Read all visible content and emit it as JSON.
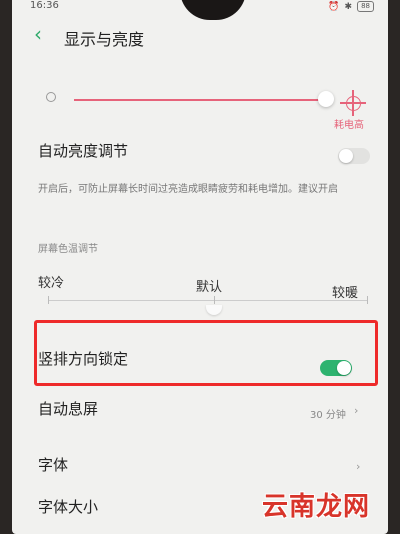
{
  "status_bar": {
    "time": "16:36",
    "battery": "88"
  },
  "header": {
    "title": "显示与亮度"
  },
  "brightness": {
    "level": 0.95,
    "high_label": "耗电高"
  },
  "auto_brightness": {
    "label": "自动亮度调节",
    "enabled": false,
    "description": "开启后，可防止屏幕长时间过亮造成眼睛疲劳和耗电增加。建议开启"
  },
  "color_temperature": {
    "section_label": "屏幕色温调节",
    "cool_label": "较冷",
    "default_label": "默认",
    "warm_label": "较暖",
    "level": 0.5
  },
  "orientation_lock": {
    "label": "竖排方向锁定",
    "enabled": true
  },
  "auto_screen_off": {
    "label": "自动息屏",
    "value": "30 分钟"
  },
  "font": {
    "label": "字体"
  },
  "font_size": {
    "label": "字体大小"
  },
  "watermark": "云南龙网",
  "colors": {
    "accent": "#2db36f",
    "brightness_track": "#e6637a",
    "highlight_box": "#ee2a2a"
  }
}
